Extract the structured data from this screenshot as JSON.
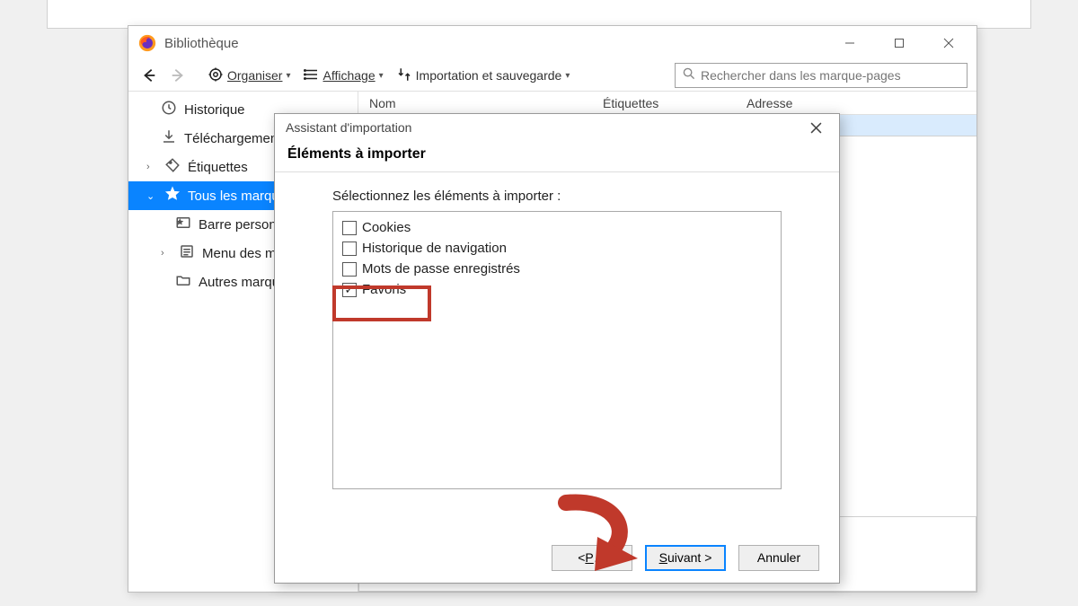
{
  "library": {
    "title": "Bibliothèque",
    "toolbar": {
      "organiser": "Organiser",
      "affichage": "Affichage",
      "import": "Importation et sauvegarde"
    },
    "search_placeholder": "Rechercher dans les marque-pages",
    "sidebar": {
      "history": "Historique",
      "downloads": "Téléchargements",
      "tags": "Étiquettes",
      "all_bookmarks": "Tous les marque…",
      "personal_bar": "Barre personn…",
      "bookmarks_menu": "Menu des ma…",
      "other_bookmarks": "Autres marqu…"
    },
    "columns": {
      "name": "Nom",
      "tags": "Étiquettes",
      "address": "Adresse"
    }
  },
  "dialog": {
    "title": "Assistant d'importation",
    "heading": "Éléments à importer",
    "instruction": "Sélectionnez les éléments à importer :",
    "options": {
      "cookies": "Cookies",
      "history": "Historique de navigation",
      "passwords": "Mots de passe enregistrés",
      "favorites": "Favoris"
    },
    "buttons": {
      "back_prefix": "< ",
      "back_ul": "P",
      "back_rest": "…",
      "next_ul": "S",
      "next_rest": "uivant >",
      "cancel": "Annuler"
    }
  }
}
